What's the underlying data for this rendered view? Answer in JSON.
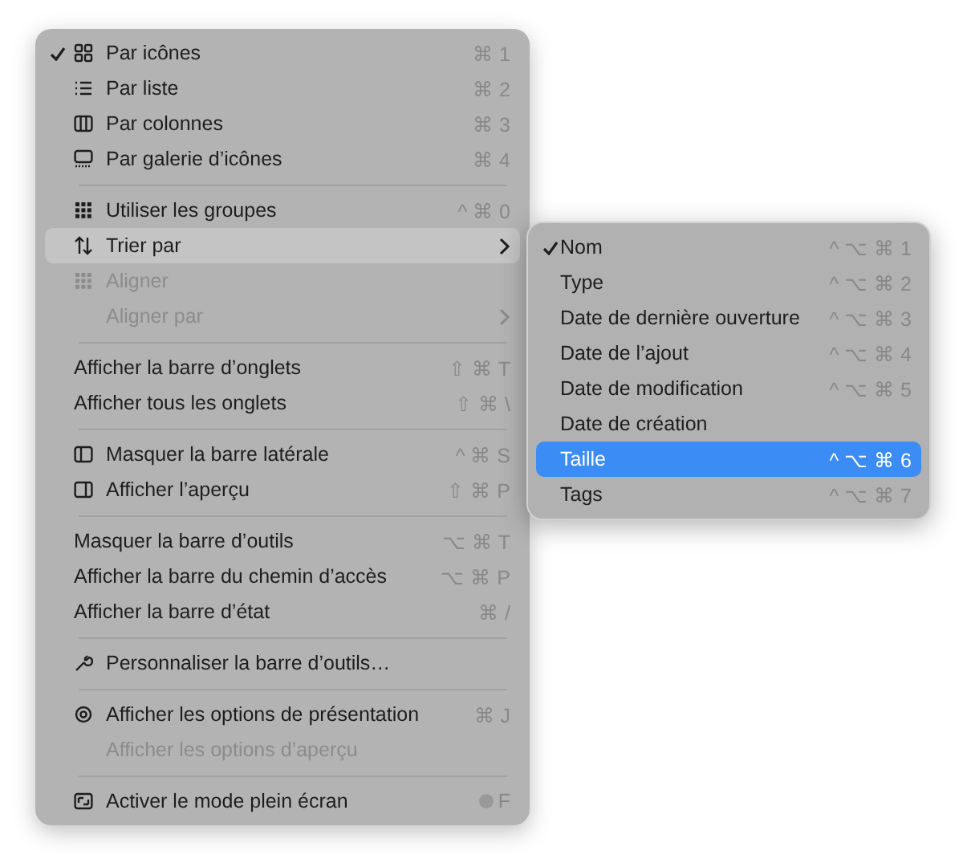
{
  "menu": {
    "sections": [
      [
        {
          "label": "Par icônes",
          "shortcut": "⌘ 1",
          "kind": "grid",
          "checked": true,
          "disabled": false,
          "selected": false,
          "submenu": false
        },
        {
          "label": "Par liste",
          "shortcut": "⌘ 2",
          "kind": "list",
          "checked": false,
          "disabled": false,
          "selected": false,
          "submenu": false
        },
        {
          "label": "Par colonnes",
          "shortcut": "⌘ 3",
          "kind": "columns",
          "checked": false,
          "disabled": false,
          "selected": false,
          "submenu": false
        },
        {
          "label": "Par galerie d’icônes",
          "shortcut": "⌘ 4",
          "kind": "gallery",
          "checked": false,
          "disabled": false,
          "selected": false,
          "submenu": false
        }
      ],
      [
        {
          "label": "Utiliser les groupes",
          "shortcut": "^ ⌘ 0",
          "kind": "groups",
          "checked": false,
          "disabled": false,
          "selected": false,
          "submenu": false
        },
        {
          "label": "Trier par",
          "kind": "sort",
          "checked": false,
          "disabled": false,
          "selected": true,
          "submenu": true
        },
        {
          "label": "Aligner",
          "kind": "align",
          "checked": false,
          "disabled": true,
          "selected": false,
          "submenu": false
        },
        {
          "label": "Aligner par",
          "kind": "spacer",
          "checked": false,
          "disabled": true,
          "selected": false,
          "submenu": true
        }
      ],
      [
        {
          "label": "Afficher la barre d’onglets",
          "shortcut": "⇧ ⌘ T",
          "kind": "plain",
          "checked": false,
          "disabled": false,
          "selected": false,
          "submenu": false
        },
        {
          "label": "Afficher tous les onglets",
          "shortcut": "⇧ ⌘ \\",
          "kind": "plain",
          "checked": false,
          "disabled": false,
          "selected": false,
          "submenu": false
        }
      ],
      [
        {
          "label": "Masquer la barre latérale",
          "shortcut": "^ ⌘ S",
          "kind": "sidebar",
          "checked": false,
          "disabled": false,
          "selected": false,
          "submenu": false
        },
        {
          "label": "Afficher l’aperçu",
          "shortcut": "⇧ ⌘ P",
          "kind": "preview",
          "checked": false,
          "disabled": false,
          "selected": false,
          "submenu": false
        }
      ],
      [
        {
          "label": "Masquer la barre d’outils",
          "shortcut": "⌥ ⌘ T",
          "kind": "plain",
          "checked": false,
          "disabled": false,
          "selected": false,
          "submenu": false
        },
        {
          "label": "Afficher la barre du chemin d’accès",
          "shortcut": "⌥ ⌘ P",
          "kind": "plain",
          "checked": false,
          "disabled": false,
          "selected": false,
          "submenu": false
        },
        {
          "label": "Afficher la barre d’état",
          "shortcut": "⌘ /",
          "kind": "plain",
          "checked": false,
          "disabled": false,
          "selected": false,
          "submenu": false
        }
      ],
      [
        {
          "label": "Personnaliser la barre d’outils…",
          "kind": "wrench",
          "checked": false,
          "disabled": false,
          "selected": false,
          "submenu": false
        }
      ],
      [
        {
          "label": "Afficher les options de présentation",
          "shortcut": "⌘ J",
          "kind": "gear",
          "checked": false,
          "disabled": false,
          "selected": false,
          "submenu": false
        },
        {
          "label": "Afficher les options d’aperçu",
          "kind": "spacer",
          "checked": false,
          "disabled": true,
          "selected": false,
          "submenu": false
        }
      ],
      [
        {
          "label": "Activer le mode plein écran",
          "shortcut": "F",
          "kind": "fullscreen",
          "checked": false,
          "disabled": false,
          "selected": false,
          "submenu": false,
          "globe": true
        }
      ]
    ]
  },
  "submenu": {
    "items": [
      {
        "label": "Nom",
        "shortcut": "^ ⌥ ⌘ 1",
        "checked": true,
        "selected": false
      },
      {
        "label": "Type",
        "shortcut": "^ ⌥ ⌘ 2",
        "checked": false,
        "selected": false
      },
      {
        "label": "Date de dernière ouverture",
        "shortcut": "^ ⌥ ⌘ 3",
        "checked": false,
        "selected": false
      },
      {
        "label": "Date de l’ajout",
        "shortcut": "^ ⌥ ⌘ 4",
        "checked": false,
        "selected": false
      },
      {
        "label": "Date de modification",
        "shortcut": "^ ⌥ ⌘ 5",
        "checked": false,
        "selected": false
      },
      {
        "label": "Date de création",
        "checked": false,
        "selected": false
      },
      {
        "label": "Taille",
        "shortcut": "^ ⌥ ⌘ 6",
        "checked": false,
        "selected": true
      },
      {
        "label": "Tags",
        "shortcut": "^ ⌥ ⌘ 7",
        "checked": false,
        "selected": false
      }
    ]
  }
}
